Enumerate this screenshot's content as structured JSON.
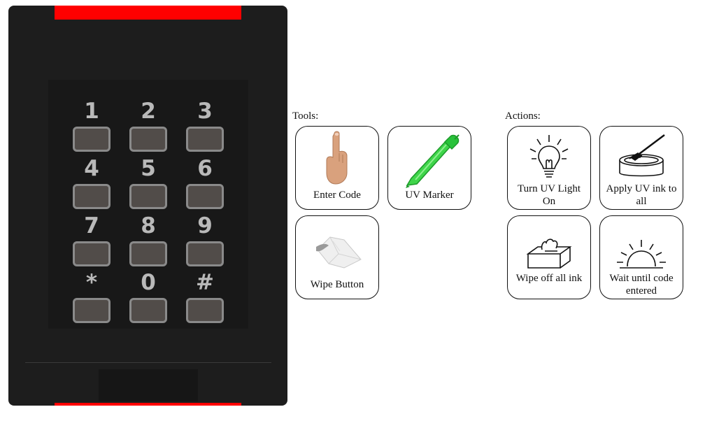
{
  "keypad": {
    "keys": [
      {
        "label": "1"
      },
      {
        "label": "2"
      },
      {
        "label": "3"
      },
      {
        "label": "4"
      },
      {
        "label": "5"
      },
      {
        "label": "6"
      },
      {
        "label": "7"
      },
      {
        "label": "8"
      },
      {
        "label": "9"
      },
      {
        "label": "*"
      },
      {
        "label": "0"
      },
      {
        "label": "#"
      }
    ],
    "led_color": "#ff0000",
    "body_color": "#1d1d1d"
  },
  "tools": {
    "heading": "Tools:",
    "items": [
      {
        "label": "Enter Code",
        "icon": "finger-press-icon"
      },
      {
        "label": "UV Marker",
        "icon": "uv-marker-icon"
      },
      {
        "label": "Wipe Button",
        "icon": "tissue-wipe-icon"
      }
    ]
  },
  "actions": {
    "heading": "Actions:",
    "items": [
      {
        "label": "Turn UV Light On",
        "icon": "light-bulb-icon"
      },
      {
        "label": "Apply UV ink to all",
        "icon": "ink-pot-brush-icon"
      },
      {
        "label": "Wipe off all ink",
        "icon": "tissue-box-icon"
      },
      {
        "label": "Wait until code entered",
        "icon": "sunrise-icon"
      }
    ]
  }
}
